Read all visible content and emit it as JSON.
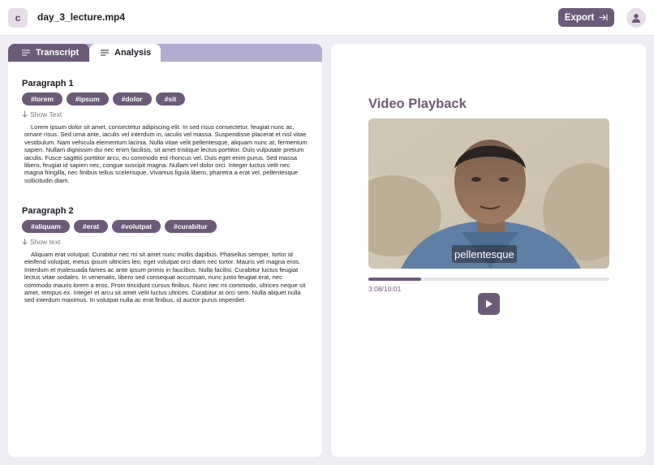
{
  "header": {
    "logo_letter": "c",
    "filename": "day_3_lecture.mp4",
    "export_label": "Export"
  },
  "tabs": [
    {
      "label": "Transcript",
      "active": false
    },
    {
      "label": "Analysis",
      "active": true
    }
  ],
  "paragraphs": [
    {
      "title": "Paragraph 1",
      "tags": [
        "#lorem",
        "#ipsum",
        "#dolor",
        "#sit"
      ],
      "show_label": "Show Text",
      "text": "Lorem ipsum dolor sit amet, consectetur adipiscing elit. In sed risus consectetur, feugiat nunc ac, ornare risus. Sed urna ante, iaculis vel interdum in, iaculis vel massa. Suspendisse placerat et nisl vitae vestibulum. Nam vehicula elementum lacinia. Nulla vitae velit pellentesque, aliquam nunc at, fermentum sapien. Nullam dignissim dui nec enim facilisis, sit amet tristique lectus porttitor. Duis vulputate pretium iaculis. Fusce sagittis porttitor arcu, eu commodo est rhoncus vel. Duis eget enim purus. Sed massa libero, feugiat id sapien nec, congue suscipit magna. Nullam vel dolor orci. Integer luctus velit nec magna fringilla, nec finibus tellus scelerisque. Vivamus ligula libero, pharetra a erat vel, pellentesque sollicitudin diam."
    },
    {
      "title": "Paragraph 2",
      "tags": [
        "#aliquam",
        "#erat",
        "#volutpat",
        "#curabitur"
      ],
      "show_label": "Show text",
      "text": "Aliquam erat volutpat. Curabitur nec mi sit amet nunc mollis dapibus. Phasellus semper, tortor id eleifend volutpat, metus ipsum ultricies leo, eget volutpat orci diam nec tortor. Mauris vel magna eros. Interdum et malesuada fames ac ante ipsum primis in faucibus. Nulla facilisi. Curabitur luctus feugiat lectus vitae sodales. In venenatis, libero sed consequat accumsan, nunc justo feugiat erat, nec commodo mauris lorem a eros. Proin tincidunt cursus finibus. Nunc nec mi commodo, ultrices neque sit amet, tempus ex. Integer et arcu sit amet velit luctus ultrices. Curabitur at orci sem. Nulla aliquet nulla sed interdum maximus. In volutpat nulla ac erat finibus, id auctor purus imperdiet."
    }
  ],
  "video": {
    "title": "Video Playback",
    "caption": "pellentesque",
    "time": "3:08/10:01",
    "progress": 0.22
  },
  "colors": {
    "accent": "#6c5a78",
    "tab_bar": "#b3abd0",
    "background": "#efedf3"
  },
  "icons": {
    "export": "export-arrow-icon",
    "avatar": "user-icon",
    "tab": "lines-icon",
    "show": "arrow-down-icon",
    "play": "play-icon"
  }
}
